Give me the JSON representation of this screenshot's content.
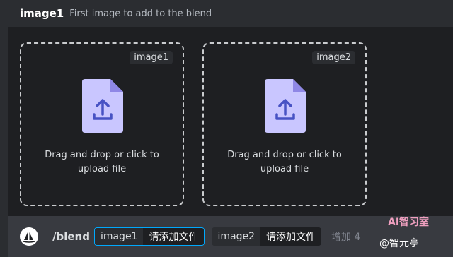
{
  "header": {
    "option_name": "image1",
    "option_description": "First image to add to the blend"
  },
  "dropzones": [
    {
      "tag": "image1",
      "label": "Drag and drop or click to upload file"
    },
    {
      "tag": "image2",
      "label": "Drag and drop or click to upload file"
    }
  ],
  "command_bar": {
    "command": "/blend",
    "chips": [
      {
        "name": "image1",
        "value": "请添加文件"
      },
      {
        "name": "image2",
        "value": "请添加文件"
      }
    ],
    "more_label": "增加 4"
  },
  "watermark": {
    "brand": "AI智习室",
    "account": "@智元亭"
  },
  "colors": {
    "panel_bg": "#1e1f22",
    "page_bg": "#2b2d31",
    "bar_bg": "#383a40",
    "file_icon": "#c9c6ff",
    "accent_blue": "#00a8fc"
  },
  "icons": {
    "upload": "upload-file-icon",
    "logo": "sailboat-logo-icon"
  }
}
